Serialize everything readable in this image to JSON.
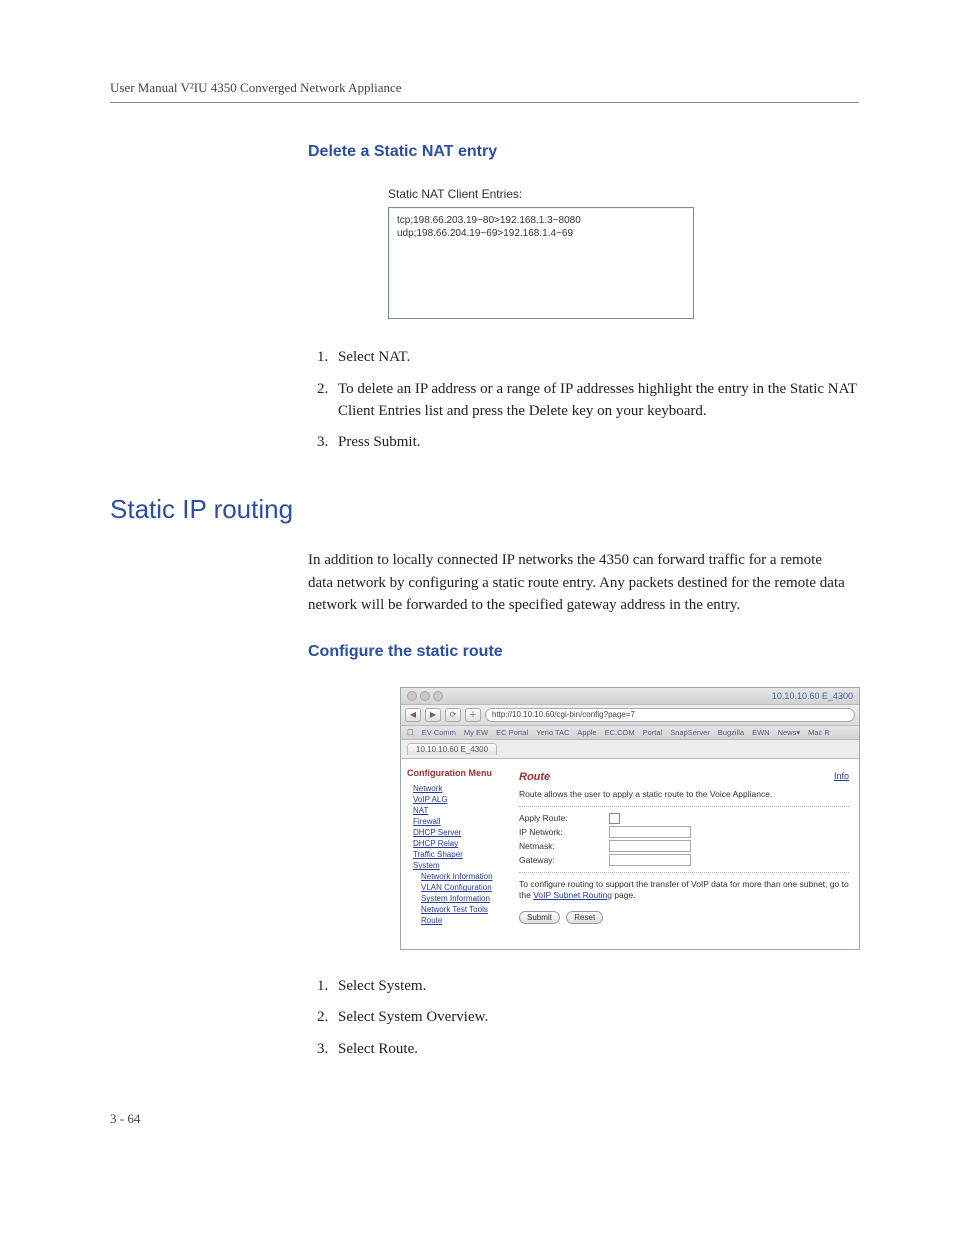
{
  "header": {
    "manual_line": "User Manual V²IU 4350 Converged Network Appliance"
  },
  "section1": {
    "title": "Delete a Static NAT entry",
    "snat_label": "Static NAT Client Entries:",
    "snat_entries": [
      "tcp;198.66.203.19~80>192.168.1.3~8080",
      "udp;198.66.204.19~69>192.168.1.4~69"
    ],
    "steps": [
      "Select NAT.",
      "To delete an IP address or a range of IP addresses highlight the entry in the Static NAT Client Entries list and press the Delete key on your keyboard.",
      "Press Submit."
    ]
  },
  "section2": {
    "title": "Static IP routing",
    "para": "In addition to locally connected IP networks the 4350 can forward traffic for a remote data network by configuring a static route entry. Any packets destined for the remote data network will be forwarded to the specified gateway address in the entry."
  },
  "section3": {
    "title": "Configure the static route",
    "browser": {
      "window_title": "10.10.10.60 E_4300",
      "url": "http://10.10.10.60/cgi-bin/config?page=7",
      "bookmarks": [
        "EV Comm",
        "My EW",
        "EC Portal",
        "Yerio TAC",
        "Apple",
        "EC.COM",
        "Portal",
        "SnapServer",
        "Bugzilla",
        "EWN",
        "News▾",
        "Mac R"
      ],
      "tab_label": "10.10.10.60 E_4300",
      "sidebar_title": "Configuration Menu",
      "sidebar": [
        "Network",
        "VoIP ALG",
        "NAT",
        "Firewall",
        "DHCP Server",
        "DHCP Relay",
        "Traffic Shaper",
        "System"
      ],
      "sidebar_sub": [
        "Network Information",
        "VLAN Configuration",
        "System Information",
        "Network Test Tools",
        "Route"
      ],
      "main_title": "Route",
      "info_link": "Info",
      "desc1": "Route allows the user to apply a static route to the Voice Appliance.",
      "fields": {
        "apply": "Apply Route:",
        "ipnet": "IP Network:",
        "mask": "Netmask:",
        "gw": "Gateway:"
      },
      "desc2_a": "To configure routing to support the transfer of VoIP data for more than one subnet, go to the ",
      "desc2_link": "VoIP Subnet Routing",
      "desc2_b": " page.",
      "submit": "Submit",
      "reset": "Reset"
    },
    "steps": [
      "Select System.",
      "Select System Overview.",
      "Select Route."
    ]
  },
  "footer": {
    "page": "3 - 64"
  }
}
